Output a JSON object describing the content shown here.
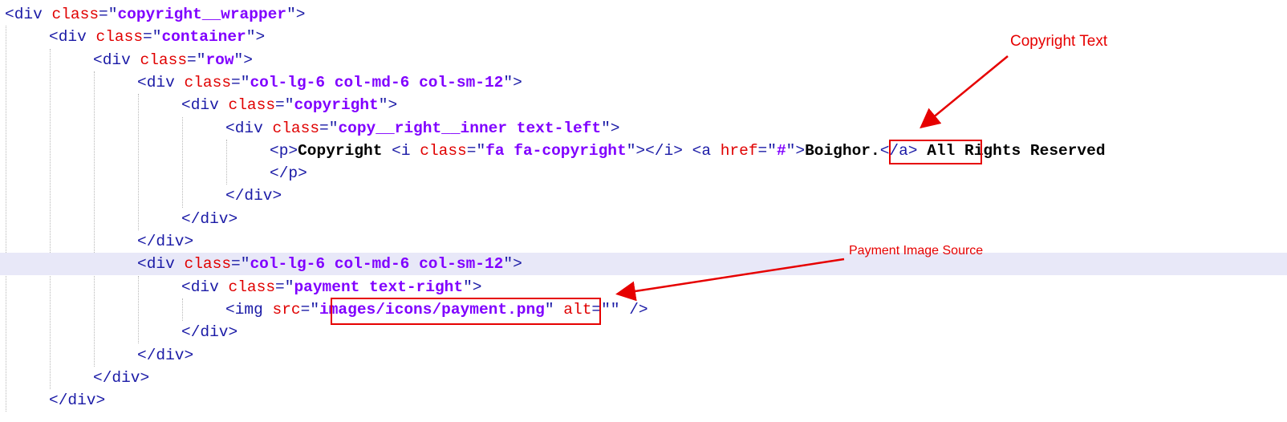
{
  "code_lines": [
    {
      "tokens": [
        [
          "tag",
          "<div "
        ],
        [
          "attr",
          "class"
        ],
        [
          "tag",
          "=\""
        ],
        [
          "val",
          "copyright__wrapper"
        ],
        [
          "tag",
          "\">"
        ]
      ]
    },
    {
      "tokens": [
        [
          "tag",
          "<div "
        ],
        [
          "attr",
          "class"
        ],
        [
          "tag",
          "=\""
        ],
        [
          "val",
          "container"
        ],
        [
          "tag",
          "\">"
        ]
      ]
    },
    {
      "tokens": [
        [
          "tag",
          "<div "
        ],
        [
          "attr",
          "class"
        ],
        [
          "tag",
          "=\""
        ],
        [
          "val",
          "row"
        ],
        [
          "tag",
          "\">"
        ]
      ]
    },
    {
      "tokens": [
        [
          "tag",
          "<div "
        ],
        [
          "attr",
          "class"
        ],
        [
          "tag",
          "=\""
        ],
        [
          "val",
          "col-lg-6 col-md-6 col-sm-12"
        ],
        [
          "tag",
          "\">"
        ]
      ]
    },
    {
      "tokens": [
        [
          "tag",
          "<div "
        ],
        [
          "attr",
          "class"
        ],
        [
          "tag",
          "=\""
        ],
        [
          "val",
          "copyright"
        ],
        [
          "tag",
          "\">"
        ]
      ]
    },
    {
      "tokens": [
        [
          "tag",
          "<div "
        ],
        [
          "attr",
          "class"
        ],
        [
          "tag",
          "=\""
        ],
        [
          "val",
          "copy__right__inner text-left"
        ],
        [
          "tag",
          "\">"
        ]
      ]
    },
    {
      "tokens": [
        [
          "tag",
          "<p>"
        ],
        [
          "txt",
          "Copyright "
        ],
        [
          "tag",
          "<i "
        ],
        [
          "attr",
          "class"
        ],
        [
          "tag",
          "=\""
        ],
        [
          "val",
          "fa fa-copyright"
        ],
        [
          "tag",
          "\"></i> <a "
        ],
        [
          "attr",
          "href"
        ],
        [
          "tag",
          "=\""
        ],
        [
          "val",
          "#"
        ],
        [
          "tag",
          "\">"
        ],
        [
          "txt",
          "Boighor."
        ],
        [
          "tag",
          "</a>"
        ],
        [
          "txt",
          " All Rights Reserved"
        ]
      ]
    },
    {
      "tokens": [
        [
          "tag",
          "</p>"
        ]
      ]
    },
    {
      "tokens": [
        [
          "tag",
          "</div>"
        ]
      ]
    },
    {
      "tokens": [
        [
          "tag",
          "</div>"
        ]
      ]
    },
    {
      "tokens": [
        [
          "tag",
          "</div>"
        ]
      ]
    },
    {
      "tokens": [
        [
          "tag",
          "<div "
        ],
        [
          "attr",
          "class"
        ],
        [
          "tag",
          "=\""
        ],
        [
          "val",
          "col-lg-6 col-md-6 col-sm-12"
        ],
        [
          "tag",
          "\">"
        ]
      ]
    },
    {
      "tokens": [
        [
          "tag",
          "<div "
        ],
        [
          "attr",
          "class"
        ],
        [
          "tag",
          "=\""
        ],
        [
          "val",
          "payment text-right"
        ],
        [
          "tag",
          "\">"
        ]
      ]
    },
    {
      "tokens": [
        [
          "tag",
          "<img "
        ],
        [
          "attr",
          "src"
        ],
        [
          "tag",
          "=\""
        ],
        [
          "val",
          "images/icons/payment.png"
        ],
        [
          "tag",
          "\" "
        ],
        [
          "attr",
          "alt"
        ],
        [
          "tag",
          "=\"\" />"
        ]
      ]
    },
    {
      "tokens": [
        [
          "tag",
          "</div>"
        ]
      ]
    },
    {
      "tokens": [
        [
          "tag",
          "</div>"
        ]
      ]
    },
    {
      "tokens": [
        [
          "tag",
          "</div>"
        ]
      ]
    },
    {
      "tokens": [
        [
          "tag",
          "</div>"
        ]
      ]
    }
  ],
  "annotations": {
    "copyright_label": "Copyright Text",
    "payment_label": "Payment Image Source"
  },
  "colors": {
    "tag": "#1a1aa6",
    "attribute": "#e00000",
    "value": "#8000ff",
    "annotation": "#e60000",
    "current_line": "#e8e8f8"
  }
}
